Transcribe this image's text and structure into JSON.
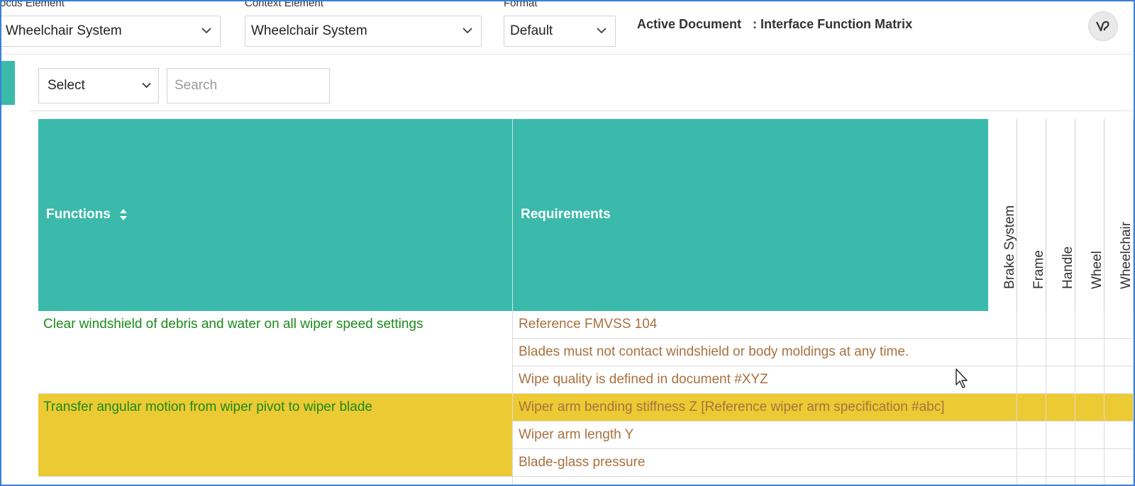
{
  "toolbar": {
    "focus_label": "ocus Element",
    "focus_value": "Wheelchair System",
    "context_label": "Context Element",
    "context_value": "Wheelchair System",
    "format_label": "Format",
    "format_value": "Default",
    "active_doc_label": "Active Document",
    "active_doc_value": ": Interface Function Matrix",
    "avatar_icon": "user-logo-icon"
  },
  "filters": {
    "select_value": "Select",
    "search_placeholder": "Search"
  },
  "matrix": {
    "functions_header": "Functions",
    "requirements_header": "Requirements",
    "columns": [
      "Brake System",
      "Frame",
      "Handle",
      "Wheel",
      "Wheelchair"
    ],
    "highlight_color": "#ecca33",
    "header_color": "#3bb9aa",
    "functions": [
      {
        "label": "Clear windshield of debris and water on all wiper speed settings"
      },
      {
        "label": "Transfer angular motion from wiper pivot to wiper blade"
      }
    ],
    "requirements": [
      {
        "label": "Reference FMVSS 104"
      },
      {
        "label": "Blades must not contact windshield or body moldings at any time."
      },
      {
        "label": "Wipe quality is defined in document #XYZ"
      },
      {
        "label": "Wiper arm bending stiffness Z [Reference wiper arm specification #abc]",
        "highlighted": true
      },
      {
        "label": "Wiper arm length Y"
      },
      {
        "label": "Blade-glass pressure"
      }
    ]
  }
}
